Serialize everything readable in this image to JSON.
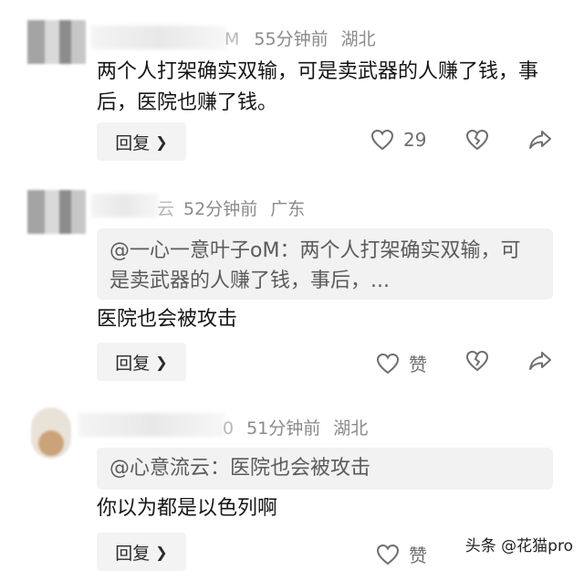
{
  "comments": [
    {
      "name_visible": "M",
      "time": "55分钟前",
      "location": "湖北",
      "quote": "",
      "text": "两个人打架确实双输，可是卖武器的人赚了钱，事后，医院也赚了钱。",
      "reply_label": "回复",
      "like_label": "29"
    },
    {
      "name_visible": "云",
      "time": "52分钟前",
      "location": "广东",
      "quote": "@一心一意叶子oM：两个人打架确实双输，可是卖武器的人赚了钱，事后，...",
      "text": "医院也会被攻击",
      "reply_label": "回复",
      "like_label": "赞"
    },
    {
      "name_visible": "0",
      "time": "51分钟前",
      "location": "湖北",
      "quote": "@心意流云：医院也会被攻击",
      "text": "你以为都是以色列啊",
      "reply_label": "回复",
      "like_label": "赞"
    }
  ],
  "icons": {
    "like": "heart-outline-icon",
    "dislike": "broken-heart-icon",
    "share": "share-arrow-icon",
    "chevron": "chevron-right-icon"
  },
  "watermark": "头条 @花猫pro"
}
